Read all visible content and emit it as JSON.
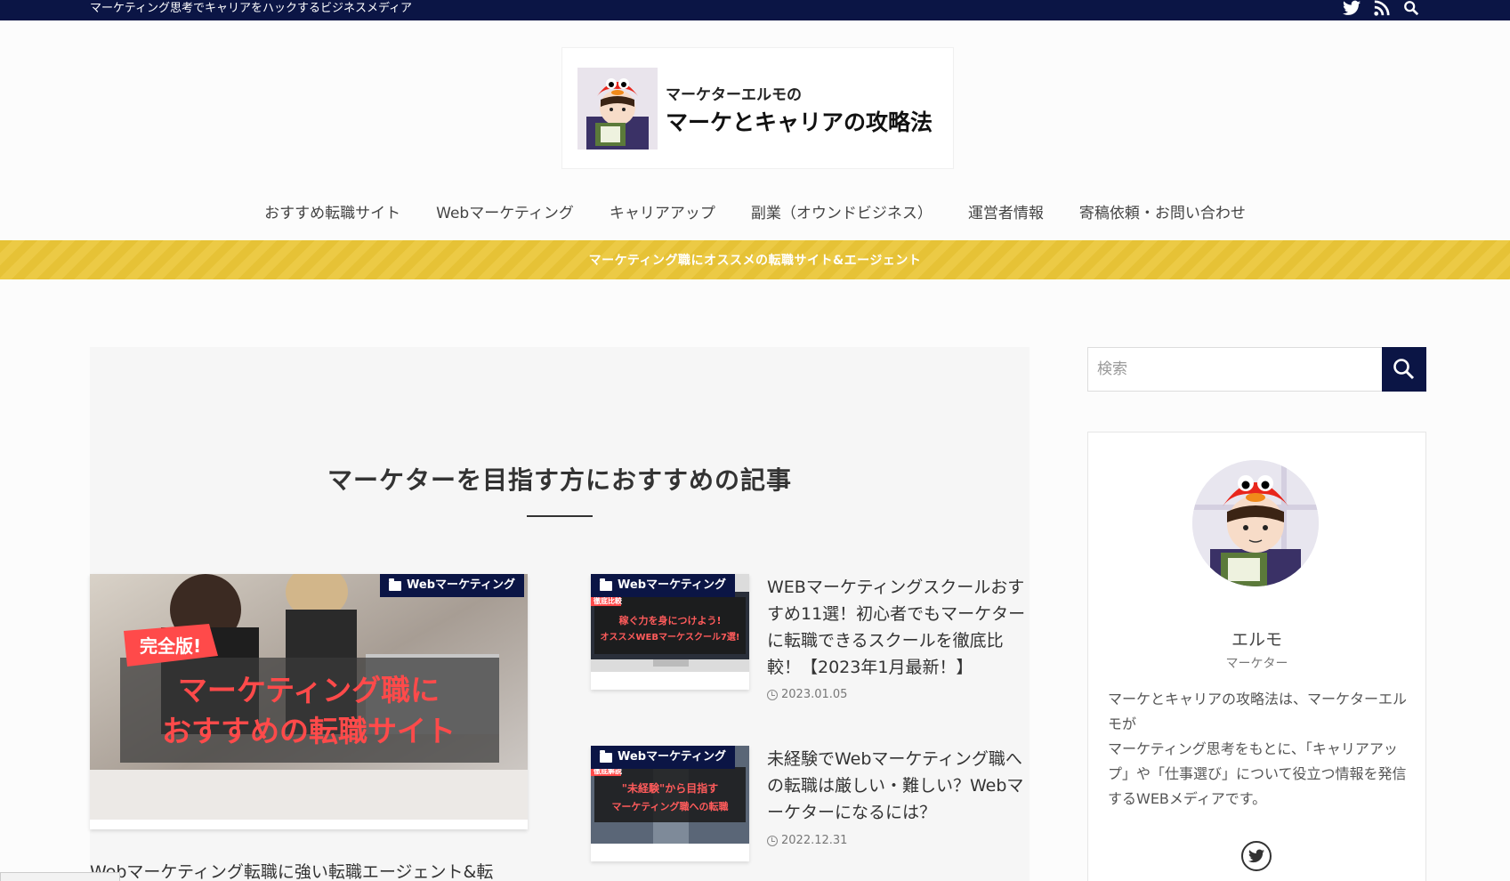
{
  "topbar": {
    "tagline": "マーケティング思考でキャリアをハックするビジネスメディア",
    "icons": [
      "twitter-icon",
      "rss-icon",
      "search-icon"
    ]
  },
  "logo": {
    "subtitle": "マーケターエルモの",
    "title": "マーケとキャリアの攻略法"
  },
  "nav": {
    "items": [
      "おすすめ転職サイト",
      "Webマーケティング",
      "キャリアアップ",
      "副業（オウンドビジネス）",
      "運営者情報",
      "寄稿依頼・お問い合わせ"
    ]
  },
  "notice": {
    "text": "マーケティング職にオススメの転職サイト&エージェント"
  },
  "main": {
    "section_title": "マーケターを目指す方におすすめの記事",
    "featured": {
      "category": "Webマーケティング",
      "thumb_badge": "完全版!",
      "thumb_line1": "マーケティング職に",
      "thumb_line2": "おすすめの転職サイト",
      "title": "Webマーケティング転職に強い転職エージェント&転"
    },
    "posts": [
      {
        "category": "Webマーケティング",
        "title": "WEBマーケティングスクールおすすめ11選！初心者でもマーケターに転職できるスクールを徹底比較！【2023年1月最新！】",
        "date": "2023.01.05",
        "thumb_tag": "徹底比較",
        "thumb_line1": "稼ぐ力を身につけよう!",
        "thumb_line2": "オススメWEBマーケスクール7選!"
      },
      {
        "category": "Webマーケティング",
        "title": "未経験でWebマーケティング職への転職は厳しい・難しい？Webマーケターになるには？",
        "date": "2022.12.31",
        "thumb_tag": "徹底解説",
        "thumb_line1": "\"未経験\"から目指す",
        "thumb_line2": "マーケティング職への転職"
      }
    ]
  },
  "sidebar": {
    "search_placeholder": "検索",
    "profile": {
      "name": "エルモ",
      "role": "マーケター",
      "bio": "マーケとキャリアの攻略法は、マーケターエルモが\nマーケティング思考をもとに、「キャリアアップ」や「仕事選び」について役立つ情報を発信するWEBメディアです。"
    }
  },
  "colors": {
    "navy": "#0b1545",
    "notice_yellow": "#e6c236",
    "red_text": "#ff4a4a"
  }
}
